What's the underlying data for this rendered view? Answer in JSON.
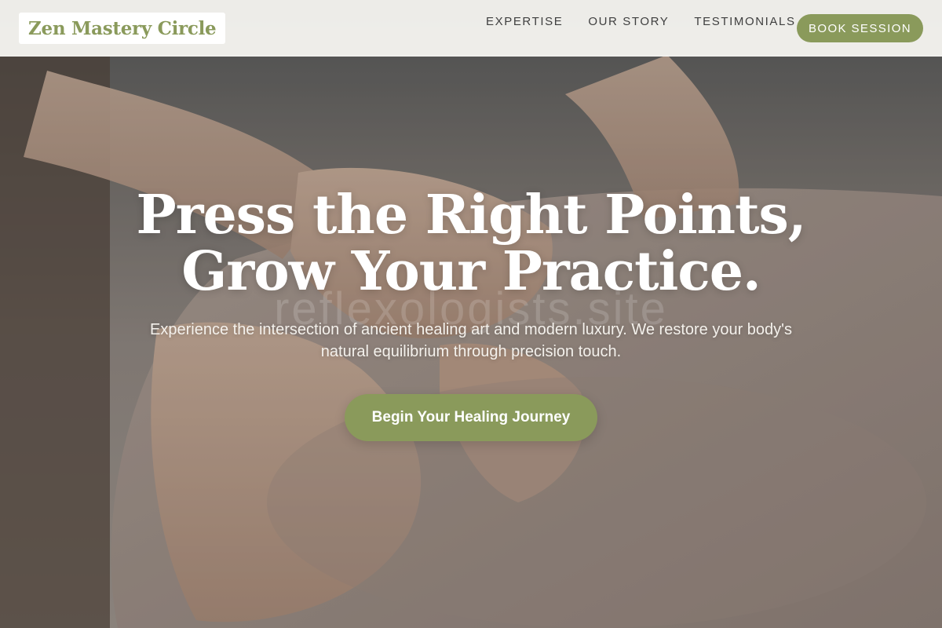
{
  "brand": {
    "name": "Zen Mastery Circle",
    "accent": "#8a9a5b"
  },
  "nav": {
    "items": [
      {
        "label": "EXPERTISE"
      },
      {
        "label": "OUR STORY"
      },
      {
        "label": "TESTIMONIALS"
      }
    ],
    "cta_label": "BOOK SESSION"
  },
  "hero": {
    "headline_line1": "Press the Right Points,",
    "headline_line2": "Grow Your Practice.",
    "subtitle": "Experience the intersection of ancient healing art and modern luxury. We restore your body's natural equilibrium through precision touch.",
    "cta_label": "Begin Your Healing Journey",
    "watermark": "reflexologists.site",
    "image_subject": "massage-hands-photo"
  }
}
